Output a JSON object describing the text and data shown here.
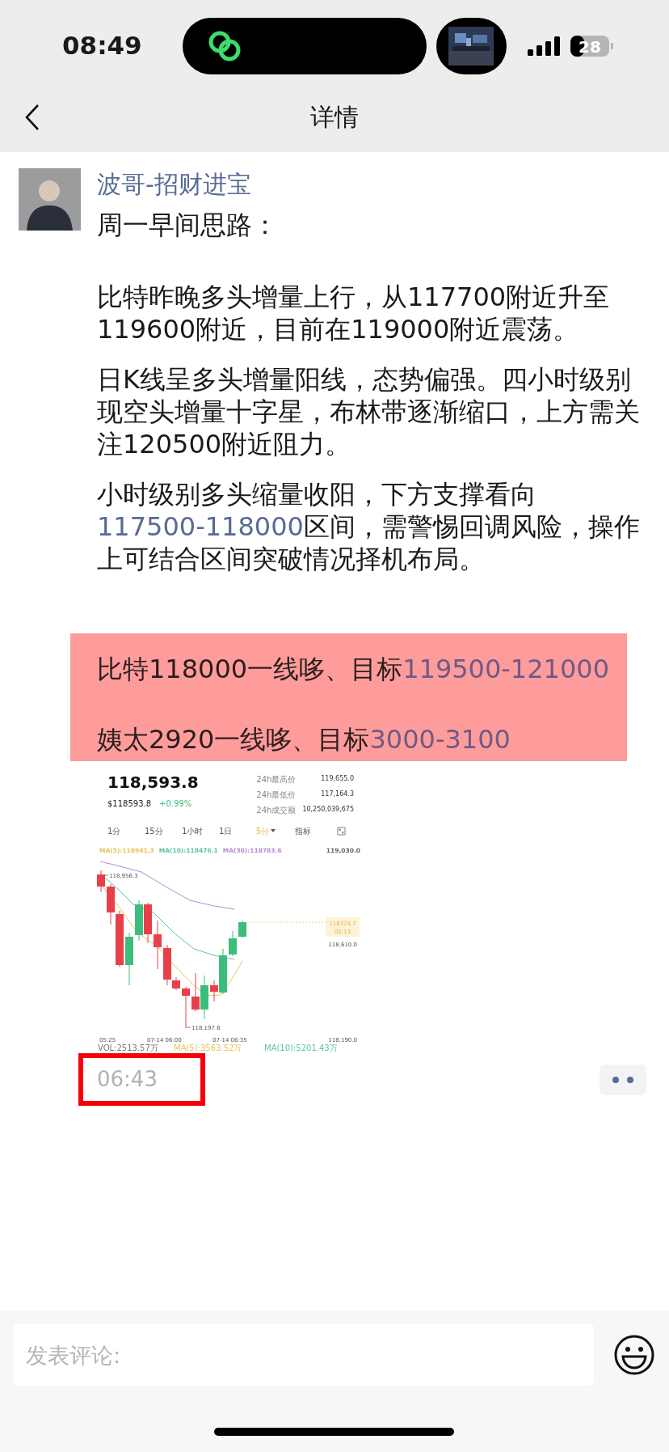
{
  "status_bar": {
    "time": "08:49",
    "battery": "28"
  },
  "nav": {
    "title": "详情"
  },
  "post": {
    "author": "波哥-招财进宝",
    "paragraphs": [
      [
        {
          "kind": "text",
          "text": "周一早间思路："
        }
      ],
      [
        {
          "kind": "text",
          "text": "比特昨晚多头增量上行，从117700附近升至119600附近，目前在119000附近震荡。"
        }
      ],
      [
        {
          "kind": "text",
          "text": "日K线呈多头增量阳线，态势偏强。四小时级别现空头增量十字星，布林带逐渐缩口，上方需关注120500附近阻力。"
        }
      ],
      [
        {
          "kind": "text",
          "text": "小时级别多头缩量收阳，下方支撑看向"
        },
        {
          "kind": "link",
          "text": "117500-118000"
        },
        {
          "kind": "text",
          "text": "区间，需警惕回调风险，操作上可结合区间突破情况择机布局。"
        }
      ]
    ],
    "highlight": [
      [
        {
          "kind": "text",
          "text": "比特118000一线哆、目标"
        },
        {
          "kind": "link",
          "text": "119500-121000"
        }
      ],
      [
        {
          "kind": "text",
          "text": "姨太2920一线哆、目标"
        },
        {
          "kind": "link",
          "text": "3000-3100"
        }
      ]
    ],
    "chart_screenshot": {
      "price": "118,593.8",
      "usd_price": "$118593.8",
      "change": "+0.99%",
      "stats": [
        {
          "label": "24h最高价",
          "value": "119,655.0"
        },
        {
          "label": "24h最低价",
          "value": "117,164.3"
        },
        {
          "label": "24h成交额",
          "value": "10,250,039,675"
        }
      ],
      "intervals": [
        {
          "label": "1分",
          "kind": "option",
          "selected": false
        },
        {
          "label": "15分",
          "kind": "option",
          "selected": false
        },
        {
          "label": "1小时",
          "kind": "option",
          "selected": false
        },
        {
          "label": "1日",
          "kind": "option",
          "selected": false
        },
        {
          "label": "5分",
          "kind": "dropdown",
          "selected": true
        }
      ],
      "indicator_button": "指标",
      "ma_legend": [
        {
          "label": "MA(5):118941.3",
          "color": "#e6c55a"
        },
        {
          "label": "MA(10):118476.1",
          "color": "#5cc4a4"
        },
        {
          "label": "MA(30):118783.6",
          "color": "#b98ad6"
        }
      ],
      "price_axis": [
        "119,030.0",
        "118,610.0",
        "118,190.0"
      ],
      "time_axis": [
        "05:25",
        "07-14 06:00",
        "07-14 06:35"
      ],
      "high_marker": "118,956.3",
      "low_marker": "118,197.6",
      "last_price": {
        "price": "118724.7",
        "countdown": "02:13"
      },
      "volume_legend": [
        {
          "label": "VOL:2513.57万",
          "color": "#777777"
        },
        {
          "label": "MA(5):3563.52万",
          "color": "#e6c55a"
        },
        {
          "label": "MA(10):5201.43万",
          "color": "#5cc4a4"
        }
      ]
    },
    "time": "06:43"
  },
  "comment_bar": {
    "placeholder": "发表评论:"
  }
}
